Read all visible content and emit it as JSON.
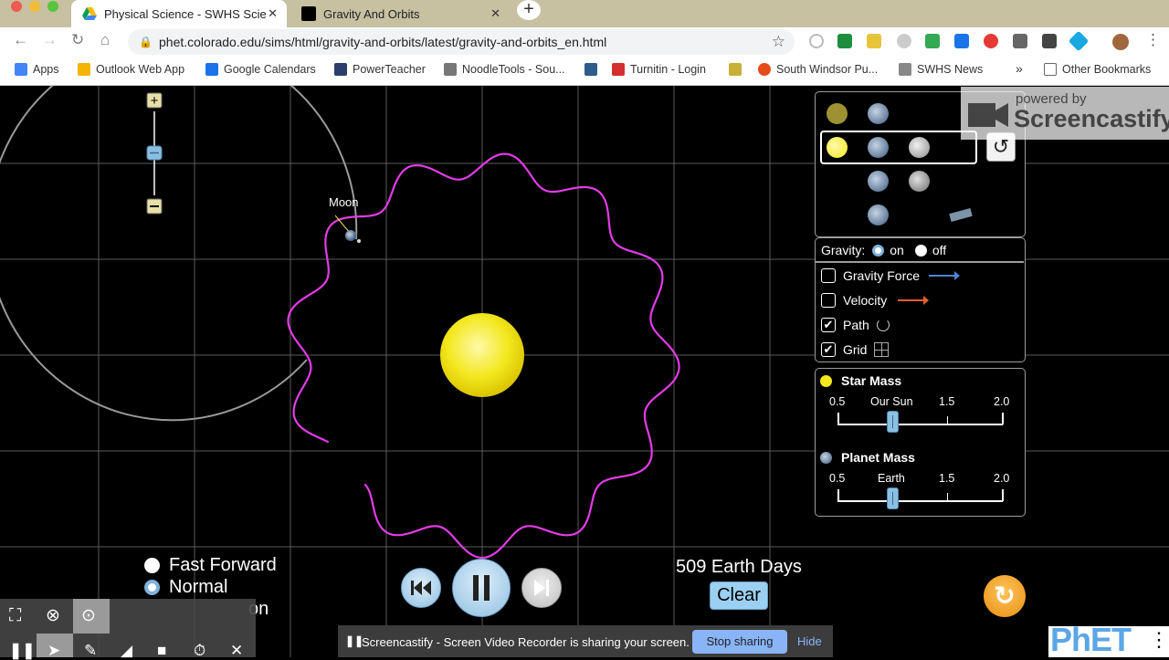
{
  "browser": {
    "tabs": [
      {
        "title": "Physical Science - SWHS Scie",
        "active": true
      },
      {
        "title": "Gravity And Orbits",
        "active": false
      }
    ],
    "url": "phet.colorado.edu/sims/html/gravity-and-orbits/latest/gravity-and-orbits_en.html",
    "bookmarks": [
      "Apps",
      "Outlook Web App",
      "Google Calendars",
      "PowerTeacher",
      "NoodleTools - Sou...",
      "Turnitin - Login",
      "South Windsor Pu...",
      "SWHS News"
    ],
    "bookmarks_more": "»",
    "other_bookmarks": "Other Bookmarks"
  },
  "sim": {
    "moon_label": "Moon",
    "gravity": {
      "label": "Gravity:",
      "on": "on",
      "off": "off",
      "selected": "on"
    },
    "checkboxes": [
      {
        "label": "Gravity Force",
        "checked": false,
        "icon": "blue-arrow-icon"
      },
      {
        "label": "Velocity",
        "checked": false,
        "icon": "orange-arrow-icon"
      },
      {
        "label": "Path",
        "checked": true,
        "icon": "path-icon"
      },
      {
        "label": "Grid",
        "checked": true,
        "icon": "grid-icon"
      }
    ],
    "star_mass": {
      "title": "Star Mass",
      "ticks": [
        "0.5",
        "Our Sun",
        "1.5",
        "2.0"
      ],
      "value": 1.0
    },
    "planet_mass": {
      "title": "Planet Mass",
      "ticks": [
        "0.5",
        "Earth",
        "1.5",
        "2.0"
      ],
      "value": 1.0
    },
    "speed_options": [
      {
        "label": "Fast Forward",
        "selected": false
      },
      {
        "label": "Normal",
        "selected": true
      },
      {
        "label": "on",
        "selected": false
      }
    ],
    "time_readout": "509 Earth Days",
    "clear_label": "Clear",
    "check_mark": "✔",
    "accent_colors": {
      "path": "#e33ce6",
      "star": "#f5ec2a",
      "button": "#9bd0f2",
      "reset": "#f5a021"
    }
  },
  "screencastify": {
    "watermark_small": "powered by",
    "watermark_big": "Screencastify",
    "share_message": "Screencastify - Screen Video Recorder is sharing your screen.",
    "stop_label": "Stop sharing",
    "hide_label": "Hide"
  },
  "phet_logo": "PhET"
}
